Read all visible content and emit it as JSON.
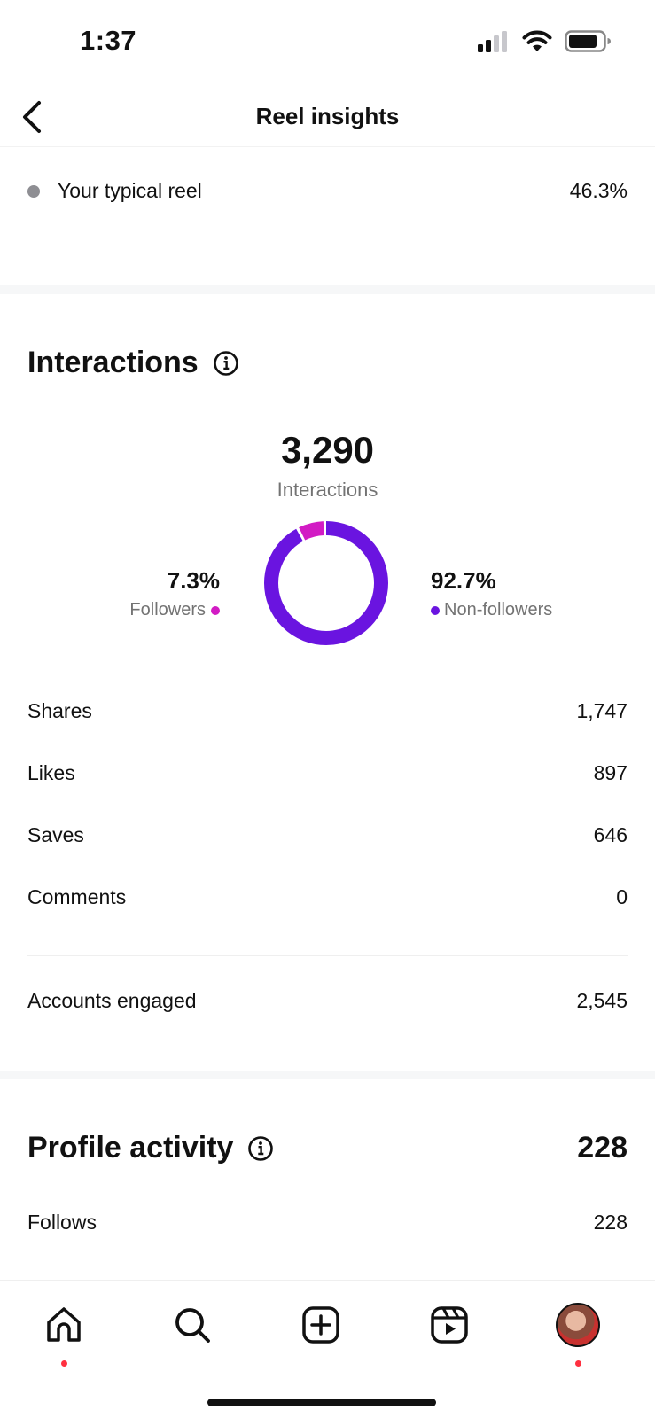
{
  "status_bar": {
    "time": "1:37"
  },
  "header": {
    "title": "Reel insights",
    "back_icon": "chevron-left-icon"
  },
  "typical_reel": {
    "label": "Your typical reel",
    "value": "46.3%"
  },
  "interactions": {
    "title": "Interactions",
    "total": "3,290",
    "total_label": "Interactions",
    "followers_pct": "7.3%",
    "followers_label": "Followers",
    "nonfollowers_pct": "92.7%",
    "nonfollowers_label": "Non-followers",
    "followers_fraction": 0.073,
    "colors": {
      "followers": "#d21bc4",
      "nonfollowers": "#6a14e0"
    },
    "rows": [
      {
        "label": "Shares",
        "value": "1,747"
      },
      {
        "label": "Likes",
        "value": "897"
      },
      {
        "label": "Saves",
        "value": "646"
      },
      {
        "label": "Comments",
        "value": "0"
      }
    ],
    "accounts_engaged": {
      "label": "Accounts engaged",
      "value": "2,545"
    }
  },
  "profile_activity": {
    "title": "Profile activity",
    "total": "228",
    "rows": [
      {
        "label": "Follows",
        "value": "228"
      }
    ]
  },
  "tab_bar": {
    "tabs": [
      "home-icon",
      "search-icon",
      "create-icon",
      "reels-icon",
      "profile-avatar"
    ],
    "notification_color": "#ff3040"
  }
}
